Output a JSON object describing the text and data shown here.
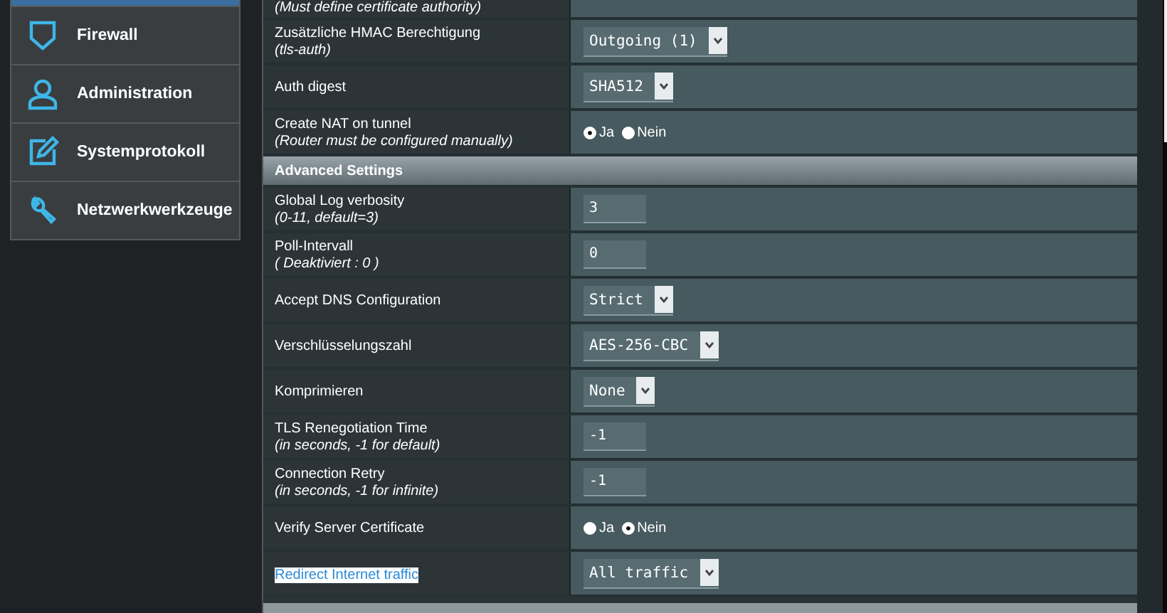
{
  "sidebar": {
    "items": [
      {
        "label": "Firewall"
      },
      {
        "label": "Administration"
      },
      {
        "label": "Systemprotokoll"
      },
      {
        "label": "Netzwerkwerkzeuge"
      }
    ]
  },
  "settings": {
    "top_row_note": "(Must define certificate authority)",
    "rows": [
      {
        "kind": "select",
        "label": "Zusätzliche HMAC Berechtigung",
        "note": "(tls-auth)",
        "value": "Outgoing (1)"
      },
      {
        "kind": "select",
        "label": "Auth digest",
        "value": "SHA512"
      },
      {
        "kind": "radio",
        "label": "Create NAT on tunnel",
        "note": "(Router must be configured manually)",
        "options": [
          {
            "label": "Ja",
            "selected": true
          },
          {
            "label": "Nein",
            "selected": false
          }
        ]
      },
      {
        "kind": "header",
        "label": "Advanced Settings"
      },
      {
        "kind": "input",
        "label": "Global Log verbosity",
        "note": "(0-11, default=3)",
        "value": "3"
      },
      {
        "kind": "input",
        "label": "Poll-Intervall",
        "note": "( Deaktiviert : 0 )",
        "value": "0"
      },
      {
        "kind": "select",
        "label": "Accept DNS Configuration",
        "value": "Strict"
      },
      {
        "kind": "select",
        "label": "Verschlüsselungszahl",
        "value": "AES-256-CBC"
      },
      {
        "kind": "select",
        "label": "Komprimieren",
        "value": "None"
      },
      {
        "kind": "input",
        "label": "TLS Renegotiation Time",
        "note": "(in seconds, -1 for default)",
        "value": "-1"
      },
      {
        "kind": "input",
        "label": "Connection Retry",
        "note": "(in seconds, -1 for infinite)",
        "value": "-1"
      },
      {
        "kind": "radio",
        "label": "Verify Server Certificate",
        "options": [
          {
            "label": "Ja",
            "selected": false
          },
          {
            "label": "Nein",
            "selected": true
          }
        ]
      },
      {
        "kind": "select",
        "label": "Redirect Internet traffic",
        "link": true,
        "value": "All traffic"
      }
    ]
  }
}
